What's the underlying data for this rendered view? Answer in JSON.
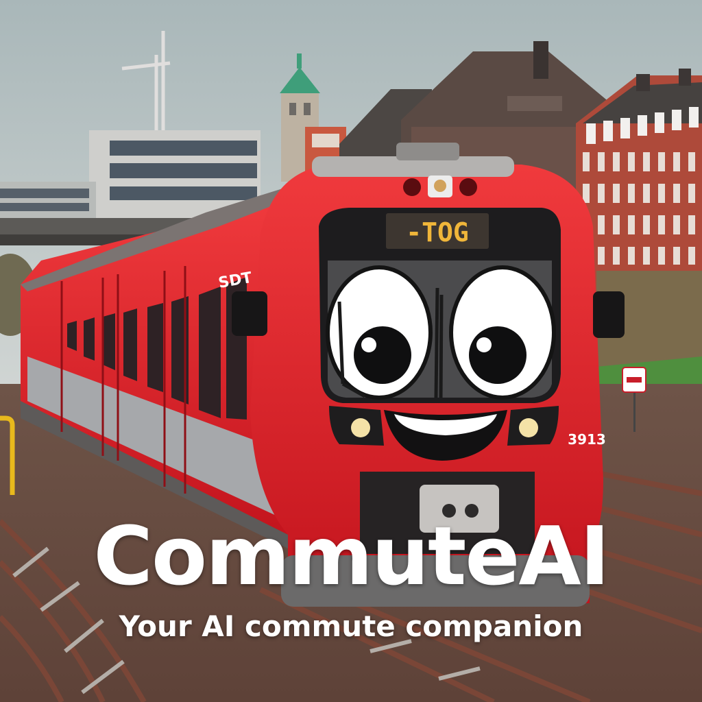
{
  "scene": {
    "destination_display": "-TOG",
    "train_number": "3913",
    "train_side_marking": "SDT",
    "colors": {
      "sky": "#b9c3c4",
      "train_red": "#e8222d",
      "train_dark_red": "#b3141c",
      "brick": "#b5503e",
      "display_amber": "#f0b63a",
      "rails": "#6d3f33",
      "ballast": "#7a5a4d",
      "grass": "#4f8f3e"
    }
  },
  "branding": {
    "title": "CommuteAI",
    "tagline": "Your AI commute companion"
  }
}
